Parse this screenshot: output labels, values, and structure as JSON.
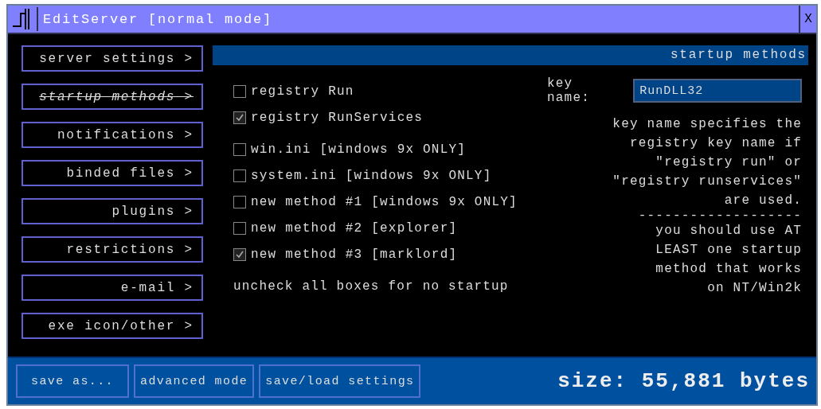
{
  "window": {
    "title": "EditServer [normal mode]",
    "close": "X"
  },
  "nav": [
    {
      "label": "server settings >",
      "selected": false
    },
    {
      "label": "startup methods >",
      "selected": true
    },
    {
      "label": "notifications >",
      "selected": false
    },
    {
      "label": "binded files >",
      "selected": false
    },
    {
      "label": "plugins >",
      "selected": false
    },
    {
      "label": "restrictions >",
      "selected": false
    },
    {
      "label": "e-mail >",
      "selected": false
    },
    {
      "label": "exe icon/other >",
      "selected": false
    }
  ],
  "section_title": "startup methods",
  "registry_options": [
    {
      "label": "registry Run",
      "checked": false
    },
    {
      "label": "registry RunServices",
      "checked": true
    }
  ],
  "other_options": [
    {
      "label": "win.ini [windows 9x ONLY]",
      "checked": false
    },
    {
      "label": "system.ini [windows 9x ONLY]",
      "checked": false
    },
    {
      "label": "new method #1 [windows 9x ONLY]",
      "checked": false
    },
    {
      "label": "new method #2 [explorer]",
      "checked": false
    },
    {
      "label": "new method #3 [marklord]",
      "checked": true
    }
  ],
  "hint": "uncheck all boxes for no startup",
  "key_name": {
    "label": "key name:",
    "value": "RunDLL32"
  },
  "key_note": "key name specifies the\nregistry key name if\n\"registry run\" or\n\"registry runservices\"\nare used.",
  "separator": "-------------------",
  "warning": "you should use AT\nLEAST one startup\nmethod that works\non NT/Win2k",
  "footer": {
    "buttons": [
      "save as...",
      "advanced mode",
      "save/load settings"
    ],
    "size": "size: 55,881 bytes"
  }
}
